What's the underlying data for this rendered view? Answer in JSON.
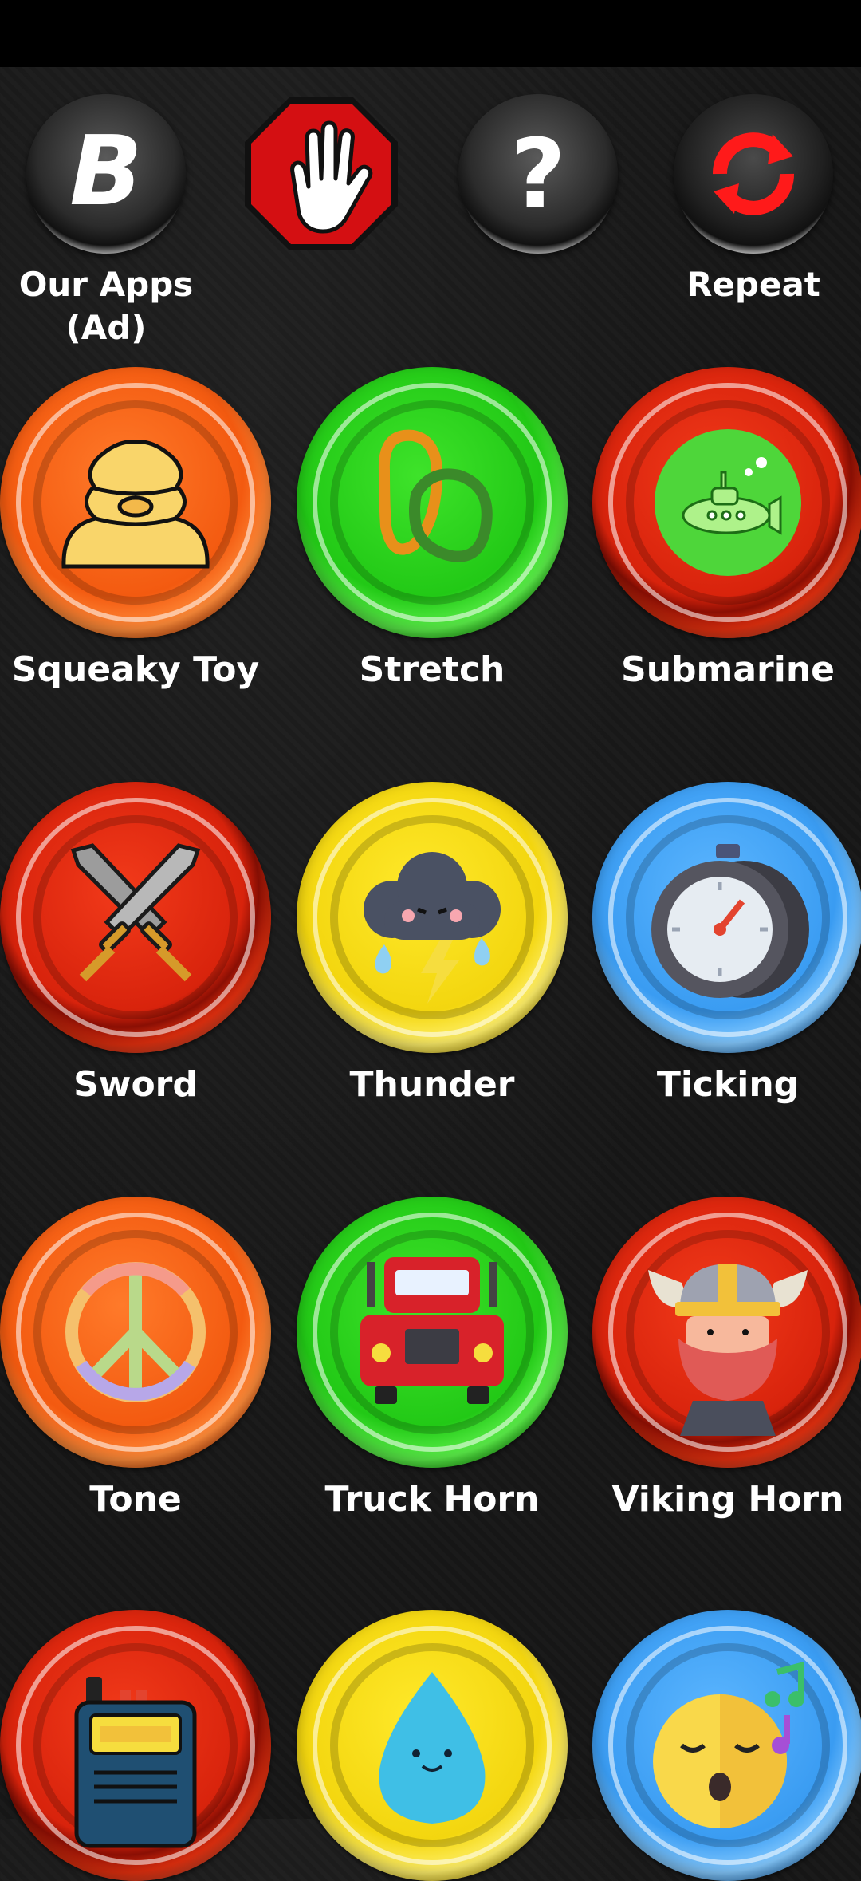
{
  "top_bar": {
    "buttons": [
      {
        "label": "Our Apps\n(Ad)",
        "icon": "b-logo-icon"
      },
      {
        "label": "",
        "icon": "stop-hand-icon"
      },
      {
        "label": "",
        "icon": "help-question-icon"
      },
      {
        "label": "Repeat",
        "icon": "repeat-arrows-icon"
      }
    ],
    "our_apps_line1": "Our Apps",
    "our_apps_line2": "(Ad)",
    "repeat_label": "Repeat"
  },
  "sounds": [
    {
      "label": "Squeaky Toy",
      "color": "orange",
      "icon": "squeaky-toy-icon"
    },
    {
      "label": "Stretch",
      "color": "green",
      "icon": "stretch-band-icon"
    },
    {
      "label": "Submarine",
      "color": "red",
      "icon": "submarine-icon"
    },
    {
      "label": "Sword",
      "color": "red",
      "icon": "crossed-swords-icon"
    },
    {
      "label": "Thunder",
      "color": "yellow",
      "icon": "thunder-cloud-icon"
    },
    {
      "label": "Ticking",
      "color": "blue",
      "icon": "stopwatch-icon"
    },
    {
      "label": "Tone",
      "color": "orange",
      "icon": "peace-sign-icon"
    },
    {
      "label": "Truck Horn",
      "color": "green",
      "icon": "truck-icon"
    },
    {
      "label": "Viking Horn",
      "color": "red",
      "icon": "viking-icon"
    },
    {
      "label": "",
      "color": "red",
      "icon": "walkie-talkie-icon"
    },
    {
      "label": "",
      "color": "yellow",
      "icon": "water-drop-icon"
    },
    {
      "label": "",
      "color": "blue",
      "icon": "singing-face-icon"
    }
  ],
  "colors": {
    "orange": "#f35a10",
    "green": "#22c916",
    "red": "#d8230c",
    "yellow": "#f3d60f",
    "blue": "#3a9cf2",
    "background": "#161616"
  }
}
